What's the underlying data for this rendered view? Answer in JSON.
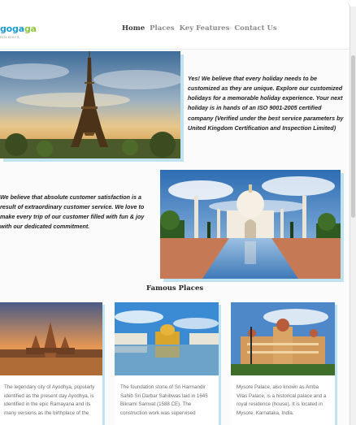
{
  "brand": {
    "logo_main_1": "goga",
    "logo_main_2": "ga",
    "logo_sub": "HOLIDAYS"
  },
  "nav": {
    "items": [
      "Home",
      "Places",
      "Key Features",
      "Contact Us"
    ],
    "active": "Home"
  },
  "section1": {
    "text": "Yes! We believe that every holiday needs to be customized as they are unique. Explore our customized holidays for a memorable holiday experience. Your next holiday is in hands of an ISO 9001-2005 certified company (Verified under the best service parameters by United Kingdom Certification and Inspection Limited)"
  },
  "section2": {
    "text": "We believe that absolute customer satisfaction is a result of extraordinary customer service. We love to make every trip of our customer filled with fun & joy with our dedicated commitment."
  },
  "famous": {
    "title": "Famous Places",
    "cards": [
      {
        "text": "The legendary city of Ayodhya, popularly identified as the present day Ayodhya, is identified in the epic Ramayana and its many versions as the birthplace of the"
      },
      {
        "text": "The foundation stone of Sri Harmandir Sahib Sri Darbar Sahibwas laid in 1645 Bikrami Samvat (1588 CE). The construction work was supervised"
      },
      {
        "text": "Mysore Palace, also known as Amba Vilas Palace, is a historical palace and a royal residence (house). It is located in Mysore, Karnataka, India."
      }
    ]
  },
  "colors": {
    "brand_blue": "#1d9bd1",
    "brand_green": "#8cc63f",
    "shadow_blue": "#bfe3f0"
  }
}
